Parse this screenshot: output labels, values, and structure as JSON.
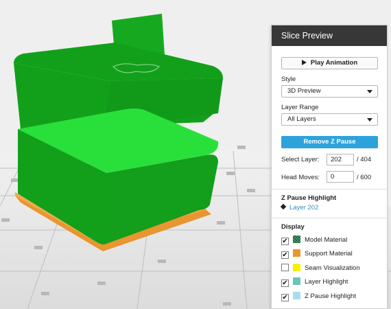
{
  "panel": {
    "title": "Slice Preview",
    "play_label": "Play Animation",
    "style_label": "Style",
    "style_value": "3D Preview",
    "layer_range_label": "Layer Range",
    "layer_range_value": "All Layers",
    "remove_zpause_label": "Remove Z Pause",
    "select_layer_label": "Select Layer:",
    "select_layer_value": "202",
    "select_layer_total": "/ 404",
    "head_moves_label": "Head Moves:",
    "head_moves_value": "0",
    "head_moves_total": "/ 600",
    "zpause_title": "Z Pause Highlight",
    "zpause_layer": "Layer 202",
    "display_title": "Display",
    "display_items": [
      {
        "label": "Model Material",
        "checked": true,
        "swatch": "#2f7a53",
        "icon": "checker-swatch"
      },
      {
        "label": "Support Material",
        "checked": true,
        "swatch": "#e8962f",
        "icon": "color-swatch"
      },
      {
        "label": "Seam Visualization",
        "checked": false,
        "swatch": "#f5f200",
        "icon": "color-swatch"
      },
      {
        "label": "Layer Highlight",
        "checked": true,
        "swatch": "#6cc3b8",
        "icon": "color-swatch"
      },
      {
        "label": "Z Pause Highlight",
        "checked": true,
        "swatch": "#a8dcf0",
        "icon": "color-swatch"
      }
    ]
  },
  "colors": {
    "model_dark": "#13a51c",
    "model_highlight": "#27e03a",
    "support": "#e8962f",
    "bed": "#e3e3e3",
    "accent_button": "#2ea3db"
  }
}
